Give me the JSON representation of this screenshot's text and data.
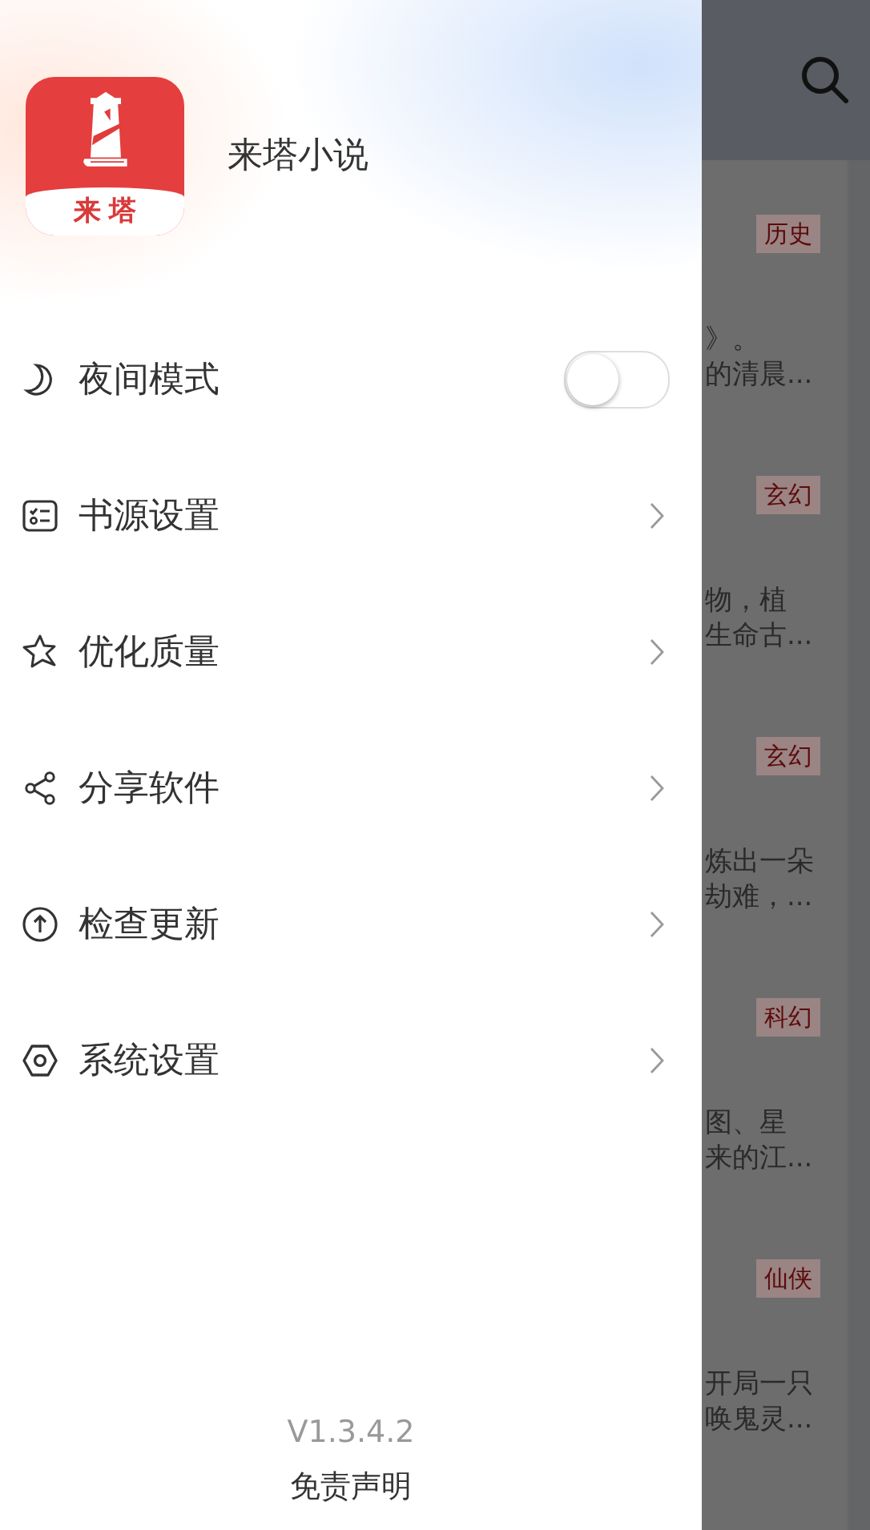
{
  "drawer": {
    "app_name": "来塔小说",
    "logo_text": "来塔",
    "menu": [
      {
        "kind": "toggle",
        "label": "夜间模式",
        "on": false
      },
      {
        "kind": "link",
        "label": "书源设置"
      },
      {
        "kind": "link",
        "label": "优化质量"
      },
      {
        "kind": "link",
        "label": "分享软件"
      },
      {
        "kind": "link",
        "label": "检查更新"
      },
      {
        "kind": "link",
        "label": "系统设置"
      }
    ],
    "footer": {
      "version": "V1.3.4.2",
      "link": "免责声明"
    }
  },
  "background_page": {
    "items": [
      {
        "tag": "历史",
        "snippet": [
          "》。",
          "的清晨..."
        ]
      },
      {
        "tag": "玄幻",
        "snippet": [
          "物，植",
          "生命古..."
        ]
      },
      {
        "tag": "玄幻",
        "snippet": [
          "炼出一朵",
          "劫难，..."
        ]
      },
      {
        "tag": "科幻",
        "snippet": [
          "图、星",
          "来的江..."
        ]
      },
      {
        "tag": "仙侠",
        "snippet": [
          "开局一只",
          "唤鬼灵..."
        ]
      }
    ]
  }
}
